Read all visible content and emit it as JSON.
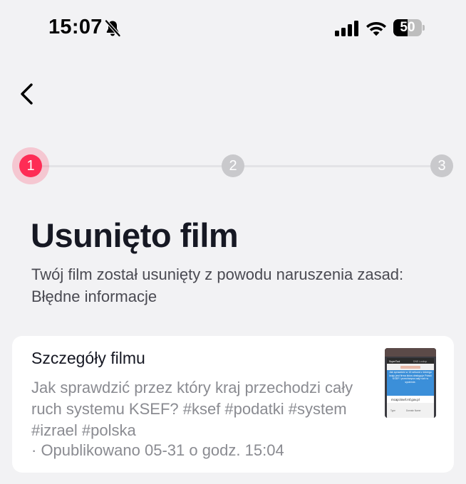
{
  "status_bar": {
    "time": "15:07",
    "battery_level": "50",
    "icons": [
      "bell-slash-icon",
      "cellular-signal-icon",
      "wifi-icon",
      "battery-icon"
    ]
  },
  "nav": {
    "back_icon": "chevron-left-icon"
  },
  "stepper": {
    "steps": [
      "1",
      "2",
      "3"
    ],
    "active_step": 1,
    "active_color": "#fe2c55",
    "inactive_color": "#c9c9cc"
  },
  "main": {
    "title": "Usunięto film",
    "subtitle": "Twój film został usunięty z powodu naruszenia zasad: Błędne informacje"
  },
  "video_card": {
    "heading": "Szczegóły filmu",
    "description": "Jak sprawdzić przez który kraj przechodzi cały ruch systemu KSEF? #ksef #podatki #system #izrael #polska",
    "meta": "· Opublikowano 05-31 o godz. 15:04",
    "thumbnail": {
      "text": "Jak sprawdzić w 15 sekund z którego kraju jest firma która obsługuje Polski KSEF i przechwyca cały ruch w systemie.",
      "url_text": "mcapi.ksef.mf.gov.pl",
      "tab_1": "SuperTool",
      "tab_2": "DNS Lookup",
      "col_1": "Type",
      "col_2": "Domain Name"
    }
  }
}
